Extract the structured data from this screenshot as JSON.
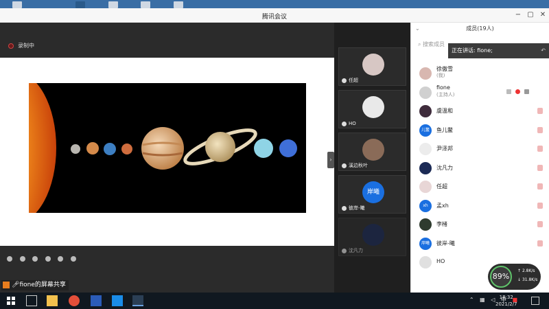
{
  "window": {
    "title": "腾讯会议"
  },
  "recording": {
    "label": "录制中"
  },
  "share": {
    "label": "fione的屏幕共享"
  },
  "videos": [
    {
      "name": "任超"
    },
    {
      "name": "HO"
    },
    {
      "name": "溪边秋叶"
    },
    {
      "name": "彼岸-曦",
      "avatar_text": "岸曦"
    },
    {
      "name": "沈凡力"
    }
  ],
  "members": {
    "header": "成员(19人)",
    "search_placeholder": "搜索成员",
    "speaking": "正在讲话: fione;",
    "list": [
      {
        "name": "徐傲雪",
        "sub": "(我)"
      },
      {
        "name": "fione",
        "sub": "(主持人)"
      },
      {
        "name": "虞溫和"
      },
      {
        "name": "鱼儿鳖",
        "avatar_text": "儿鳖"
      },
      {
        "name": "尹泽邦"
      },
      {
        "name": "沈凡力"
      },
      {
        "name": "任超"
      },
      {
        "name": "孟xh",
        "avatar_text": "xh"
      },
      {
        "name": "李楮"
      },
      {
        "name": "彼岸-曦",
        "avatar_text": "岸曦"
      },
      {
        "name": "HO"
      }
    ]
  },
  "network": {
    "quality": "89%",
    "up": "2.8K/s",
    "down": "31.8K/s"
  },
  "taskbar": {
    "ime": "中",
    "time": "18:32",
    "date": "2021/2/7"
  }
}
